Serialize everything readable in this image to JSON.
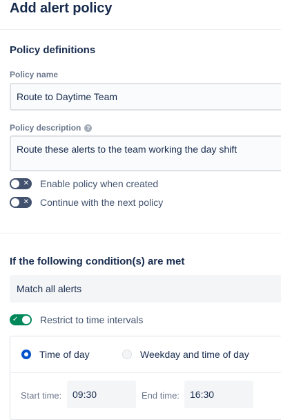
{
  "page": {
    "title": "Add alert policy"
  },
  "policy_definitions": {
    "section_title": "Policy definitions",
    "name_label": "Policy name",
    "name_value": "Route to Daytime Team",
    "description_label": "Policy description",
    "description_help_icon": "?",
    "description_value": "Route these alerts to the team working the day shift",
    "toggles": [
      {
        "label": "Enable policy when created",
        "state": "off",
        "glyph": "✕"
      },
      {
        "label": "Continue with the next policy",
        "state": "off",
        "glyph": "✕"
      }
    ]
  },
  "conditions": {
    "section_title": "If the following condition(s) are met",
    "match_value": "Match all alerts",
    "restrict_toggle": {
      "label": "Restrict to time intervals",
      "state": "on",
      "glyph": "✓"
    }
  },
  "time_intervals": {
    "options": [
      {
        "label": "Time of day",
        "selected": true
      },
      {
        "label": "Weekday and time of day",
        "selected": false
      }
    ],
    "start_label": "Start time:",
    "start_value": "09:30",
    "end_label": "End time:",
    "end_value": "16:30"
  },
  "colors": {
    "toggle_off": "#42526e",
    "toggle_on": "#00875a",
    "radio_selected": "#0052cc"
  }
}
